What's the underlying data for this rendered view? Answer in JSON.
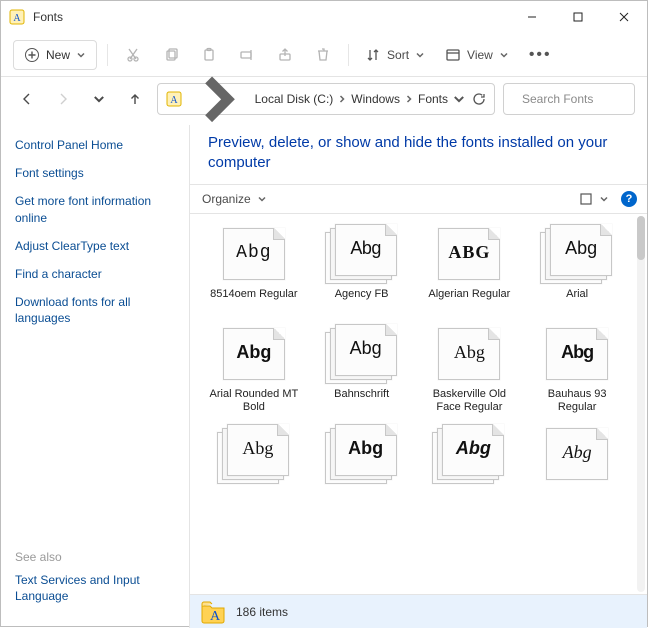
{
  "window": {
    "title": "Fonts"
  },
  "commandbar": {
    "new": "New",
    "sort": "Sort",
    "view": "View"
  },
  "breadcrumb": {
    "parts": [
      "Local Disk (C:)",
      "Windows",
      "Fonts"
    ]
  },
  "search": {
    "placeholder": "Search Fonts"
  },
  "sidebar": {
    "items": [
      {
        "label": "Control Panel Home"
      },
      {
        "label": "Font settings"
      },
      {
        "label": "Get more font information online"
      },
      {
        "label": "Adjust ClearType text"
      },
      {
        "label": "Find a character"
      },
      {
        "label": "Download fonts for all languages"
      }
    ],
    "seealso_header": "See also",
    "seealso": [
      {
        "label": "Text Services and Input Language"
      }
    ]
  },
  "header": {
    "title": "Preview, delete, or show and hide the fonts installed on your computer"
  },
  "organize": {
    "label": "Organize"
  },
  "fonts": [
    {
      "label": "8514oem Regular",
      "sample": "Abg",
      "cls": "ff-8514oem",
      "family": false
    },
    {
      "label": "Agency FB",
      "sample": "Abg",
      "cls": "ff-agency",
      "family": true
    },
    {
      "label": "Algerian Regular",
      "sample": "ABG",
      "cls": "ff-algerian",
      "family": false
    },
    {
      "label": "Arial",
      "sample": "Abg",
      "cls": "ff-arial",
      "family": true
    },
    {
      "label": "Arial Rounded MT Bold",
      "sample": "Abg",
      "cls": "ff-arialrnd",
      "family": false
    },
    {
      "label": "Bahnschrift",
      "sample": "Abg",
      "cls": "ff-bahnschrift",
      "family": true
    },
    {
      "label": "Baskerville Old Face Regular",
      "sample": "Abg",
      "cls": "ff-baskerville",
      "family": false
    },
    {
      "label": "Bauhaus 93 Regular",
      "sample": "Abg",
      "cls": "ff-bauhaus",
      "family": false
    },
    {
      "label": "",
      "sample": "Abg",
      "cls": "ff-serif1",
      "family": true
    },
    {
      "label": "",
      "sample": "Abg",
      "cls": "ff-bold1",
      "family": true
    },
    {
      "label": "",
      "sample": "Abg",
      "cls": "ff-black1",
      "family": true
    },
    {
      "label": "",
      "sample": "Abg",
      "cls": "ff-script1",
      "family": false
    }
  ],
  "status": {
    "count_text": "186 items"
  }
}
